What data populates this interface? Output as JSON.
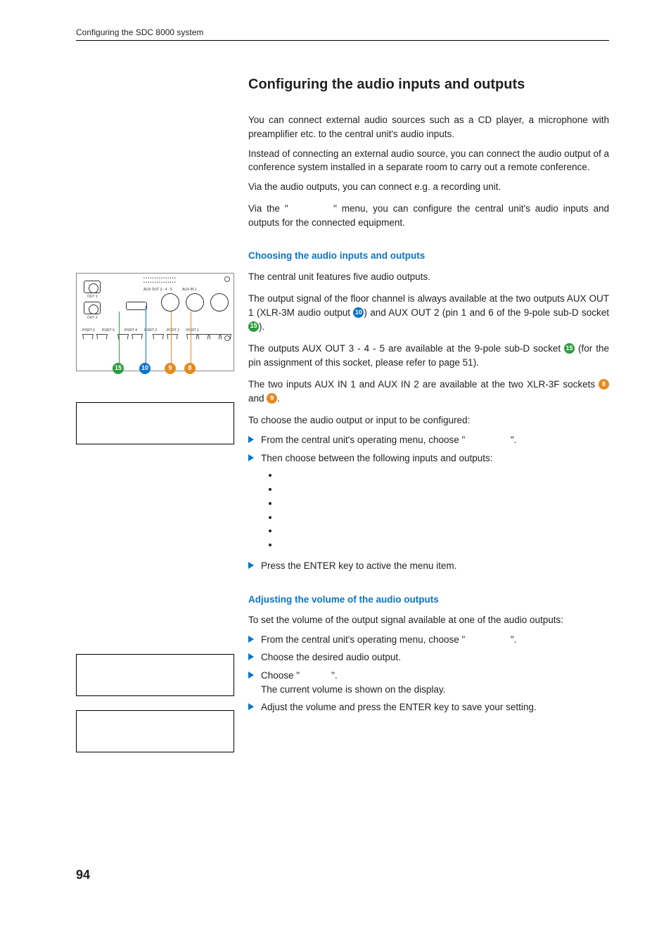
{
  "header": {
    "running": "Configuring the SDC 8000 system"
  },
  "page_number": "94",
  "title": "Configuring the audio inputs and outputs",
  "intro": {
    "p1": "You can connect external audio sources such as a CD player, a microphone with preamplifier etc. to the central unit's audio inputs.",
    "p2": "Instead of connecting an external audio source, you can connect the audio output of a conference system installed in a separate room to carry out a remote conference.",
    "p3": "Via the audio outputs, you can connect e.g. a recording unit.",
    "p4a": "Via the \"",
    "p4b": "\" menu, you can configure the central unit's audio inputs and outputs for the connected equipment."
  },
  "sub1": "Choosing the audio inputs and outputs",
  "s1": {
    "p1": "The central unit features five audio outputs.",
    "p2a": "The output signal of the floor channel is always available at the two outputs AUX OUT 1 (XLR-3M audio output ",
    "p2b": ") and AUX OUT 2 (pin 1 and 6 of the 9-pole sub-D socket ",
    "p2c": ").",
    "p3a": "The outputs AUX OUT 3 - 4 - 5 are available at the 9-pole sub-D socket ",
    "p3b": " (for the pin assignment of this socket, please refer to page 51).",
    "p4a": "The two inputs AUX IN 1 and AUX IN 2 are available at the two XLR-3F sockets ",
    "p4b": " and ",
    "p4c": ".",
    "p5": "To choose the audio output or input to be configured:",
    "step1a": "From the central unit's operating menu, choose \"",
    "step1b": "\".",
    "step2": "Then choose between the following inputs and outputs:",
    "step3": "Press the ENTER key to active the menu item."
  },
  "sub2": "Adjusting the volume of the audio outputs",
  "s2": {
    "p1": "To set the volume of the output signal available at one of the audio outputs:",
    "step1a": "From the central unit's operating menu, choose \"",
    "step1b": "\".",
    "step2": "Choose the desired audio output.",
    "step3a": "Choose \"",
    "step3b": "\".",
    "step3line2": "The current volume is shown on the display.",
    "step4": "Adjust the volume and press the ENTER key to save your setting."
  },
  "callouts": {
    "ten": "10",
    "fifteen": "15",
    "eight": "8",
    "nine": "9"
  }
}
